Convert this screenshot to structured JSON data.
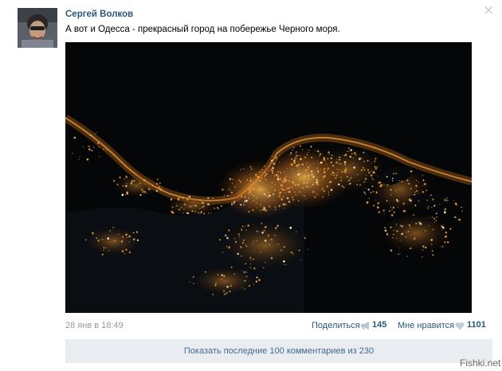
{
  "post": {
    "author": "Сергей Волков",
    "text": "А вот и Одесса - прекрасный город на побережье Черного моря.",
    "date": "28 янв в 18:49",
    "share_label": "Поделиться",
    "share_count": "145",
    "like_label": "Мне нравится",
    "like_count": "1101",
    "comments_button": "Показать последние 100 комментариев из 230",
    "close_icon": "close-icon"
  },
  "watermark": "Fishki.net",
  "colors": {
    "link": "#2b587a",
    "muted": "#999999",
    "button_bg": "#e9edf1",
    "button_text": "#45688e",
    "photo_bg": "#050608",
    "city_lights": "#f0a23c"
  }
}
